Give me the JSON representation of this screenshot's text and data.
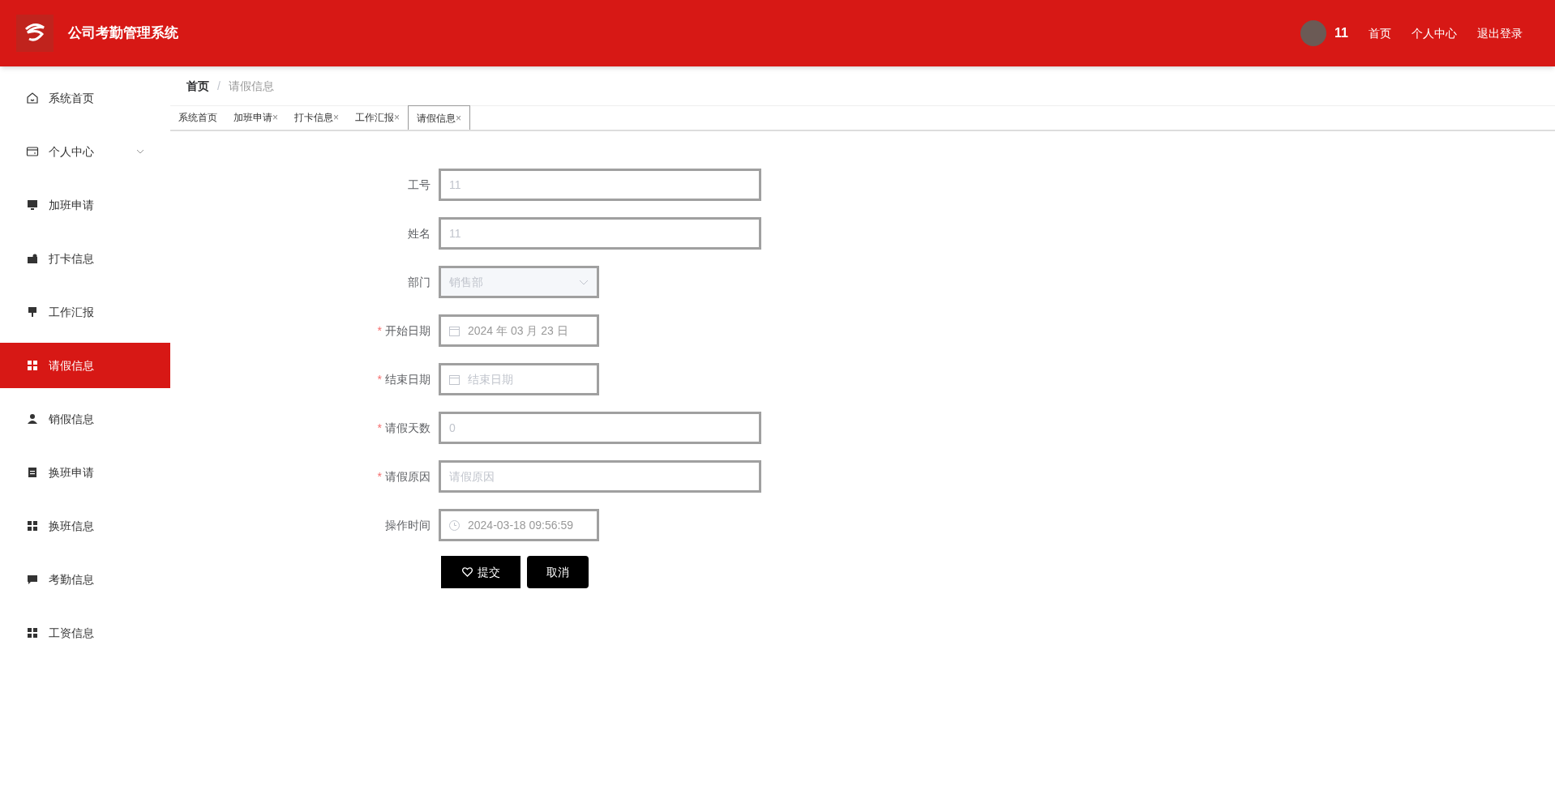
{
  "header": {
    "title": "公司考勤管理系统",
    "user": "11",
    "links": [
      "首页",
      "个人中心",
      "退出登录"
    ]
  },
  "sidebar": {
    "items": [
      {
        "label": "系统首页",
        "selected": false
      },
      {
        "label": "个人中心",
        "selected": false,
        "expanded": false
      },
      {
        "label": "加班申请",
        "selected": false
      },
      {
        "label": "打卡信息",
        "selected": false
      },
      {
        "label": "工作汇报",
        "selected": false
      },
      {
        "label": "请假信息",
        "selected": true
      },
      {
        "label": "销假信息",
        "selected": false
      },
      {
        "label": "换班申请",
        "selected": false
      },
      {
        "label": "换班信息",
        "selected": false
      },
      {
        "label": "考勤信息",
        "selected": false
      },
      {
        "label": "工资信息",
        "selected": false
      }
    ]
  },
  "breadcrumb": {
    "items": [
      "首页",
      "请假信息"
    ],
    "separator": "/"
  },
  "tabs": [
    {
      "label": "系统首页",
      "selected": false
    },
    {
      "label": "加班申请",
      "selected": false,
      "close": "×"
    },
    {
      "label": "打卡信息",
      "selected": false,
      "close": "×"
    },
    {
      "label": "工作汇报",
      "selected": false,
      "close": "×"
    },
    {
      "label": "请假信息",
      "selected": true,
      "close": "×"
    }
  ],
  "form": {
    "fields": [
      {
        "label": "工号",
        "kind": "text",
        "disabled": true,
        "value": "11"
      },
      {
        "label": "姓名",
        "kind": "text",
        "disabled": true,
        "value": "11"
      },
      {
        "label": "部门",
        "kind": "select",
        "disabled": true,
        "value": "销售部"
      },
      {
        "label": "开始日期",
        "kind": "date",
        "required_mark": "*",
        "disabled": false,
        "value": "2024 年 03 月 23 日"
      },
      {
        "label": "结束日期",
        "kind": "date",
        "required_mark": "*",
        "placeholder": "结束日期"
      },
      {
        "label": "请假天数",
        "kind": "text",
        "required_mark": "*",
        "disabled": true,
        "value": "0"
      },
      {
        "label": "请假原因",
        "kind": "text",
        "required_mark": "*",
        "placeholder": "请假原因"
      },
      {
        "label": "操作时间",
        "kind": "datetime",
        "disabled": false,
        "value": "2024-03-18 09:56:59"
      }
    ],
    "buttons": [
      {
        "label": "提交",
        "kind": "submit"
      },
      {
        "label": "取消",
        "kind": "cancel"
      }
    ]
  }
}
